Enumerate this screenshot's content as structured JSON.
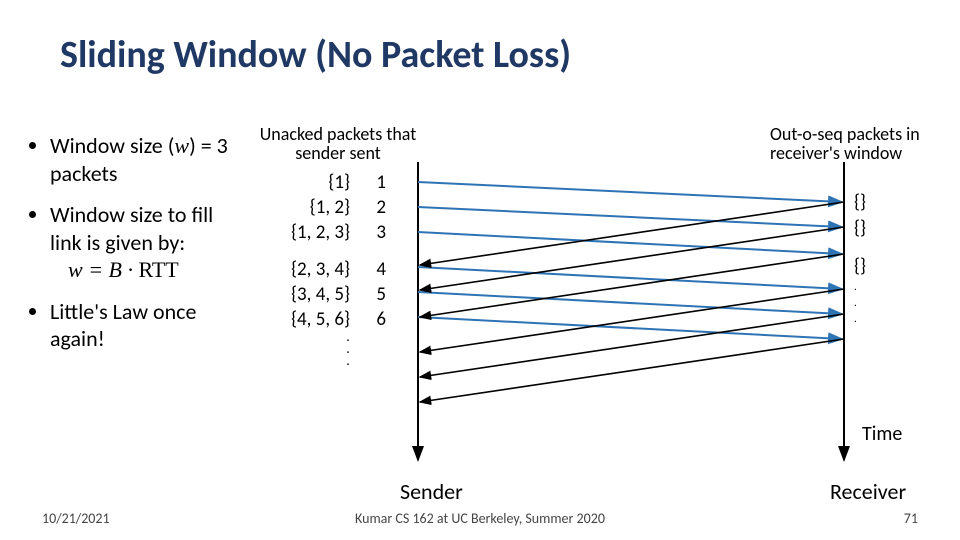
{
  "title": "Sliding Window (No Packet Loss)",
  "bullets": {
    "b1_prefix": "Window size (",
    "b1_var": "w",
    "b1_suffix": ") = 3 packets",
    "b2": "Window size to fill link is given by:",
    "b2_formula_lhs_var": "w",
    "b2_formula_eq": " = ",
    "b2_formula_B": "B",
    "b2_formula_dot": " · ",
    "b2_formula_rtt": "RTT",
    "b3": "Little's Law once again!"
  },
  "labels": {
    "unacked": "Unacked packets that sender sent",
    "ooseq": "Out-o-seq packets in receiver's window",
    "time": "Time",
    "sender": "Sender",
    "receiver": "Receiver"
  },
  "sender_rows": [
    {
      "set": "{1}",
      "num": "1"
    },
    {
      "set": "{1, 2}",
      "num": "2"
    },
    {
      "set": "{1, 2, 3}",
      "num": "3"
    },
    {
      "set": "{2, 3, 4}",
      "num": "4"
    },
    {
      "set": "{3, 4, 5}",
      "num": "5"
    },
    {
      "set": "{4, 5, 6}",
      "num": "6"
    }
  ],
  "receiver_rows": [
    "{}",
    "{}",
    "{}"
  ],
  "footer": {
    "date": "10/21/2021",
    "center": "Kumar CS 162 at UC Berkeley, Summer 2020",
    "page": "71"
  },
  "colors": {
    "title": "#1f3864",
    "packet_arrow": "#2e74b5",
    "ack_arrow": "#000000"
  },
  "chart_data": {
    "type": "sequence-diagram",
    "title": "Sliding Window (No Packet Loss)",
    "window_size_packets": 3,
    "formula": "w = B · RTT",
    "sender_unacked_sets": [
      "{1}",
      "{1,2}",
      "{1,2,3}",
      "{2,3,4}",
      "{3,4,5}",
      "{4,5,6}"
    ],
    "packets_sent": [
      1,
      2,
      3,
      4,
      5,
      6
    ],
    "receiver_out_of_seq_sets": [
      "{}",
      "{}",
      "{}"
    ],
    "acks_returned": 6,
    "note": "Packets (blue arrows) go Sender→Receiver; ACKs (black arrows) go Receiver→Sender; ellipsis indicates continuation"
  }
}
